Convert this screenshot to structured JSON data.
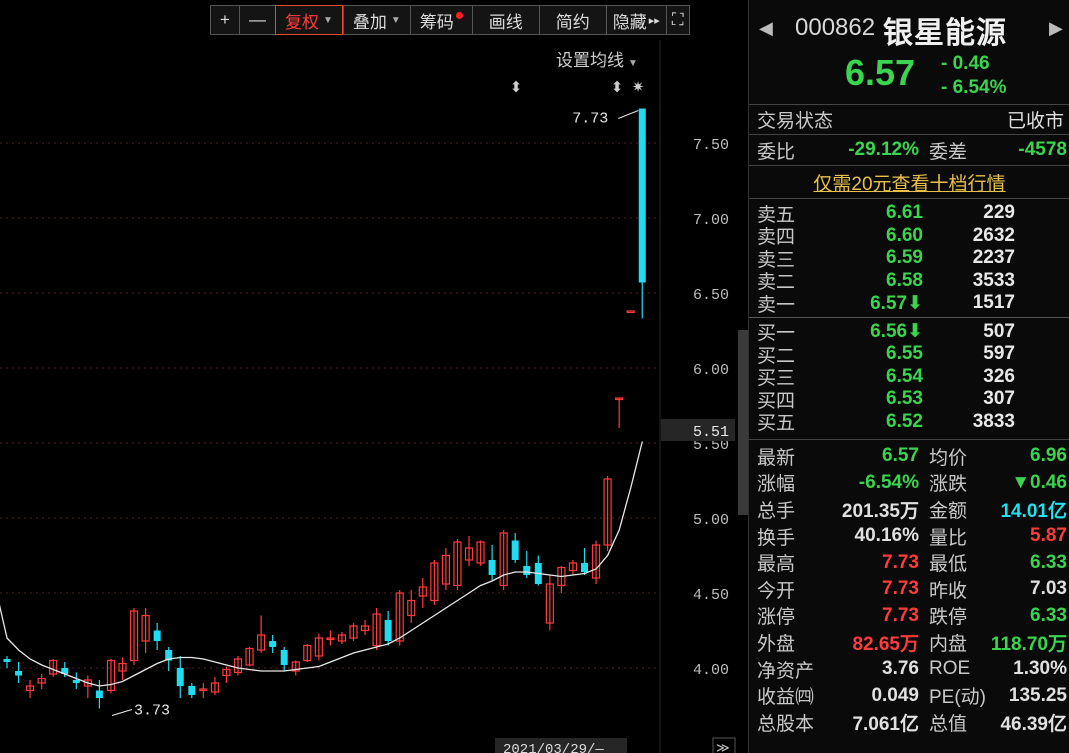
{
  "toolbar": {
    "items": [
      "+",
      "—",
      "复权",
      "叠加",
      "筹码",
      "画线",
      "简约",
      "隐藏",
      "⛶"
    ],
    "hidden_arrow": "▸▸"
  },
  "chart": {
    "ma_settings": "设置均线",
    "date_label": "2021/03/29/—",
    "peak_label": "7.73",
    "trough_label": "3.73",
    "current_price_tag": "5.51",
    "markers": [
      "⬍",
      "⬍",
      "✷"
    ],
    "nav_icon": "≫"
  },
  "chart_data": {
    "type": "candlestick",
    "y_ticks": [
      "7.50",
      "7.00",
      "6.50",
      "6.00",
      "5.50",
      "5.00",
      "4.50",
      "4.00"
    ],
    "ylim": [
      3.6,
      7.85
    ],
    "colors": {
      "up": "#ff3b3b",
      "down": "#21dcf0",
      "ma": "#e8e8e8"
    },
    "candles": [
      [
        4.06,
        4.08,
        4.0,
        4.04
      ],
      [
        3.98,
        4.04,
        3.9,
        3.95
      ],
      [
        3.85,
        3.92,
        3.8,
        3.88
      ],
      [
        3.9,
        3.96,
        3.86,
        3.93
      ],
      [
        3.96,
        4.06,
        3.94,
        4.05
      ],
      [
        4.0,
        4.04,
        3.94,
        3.96
      ],
      [
        3.92,
        3.97,
        3.86,
        3.9
      ],
      [
        3.88,
        3.95,
        3.8,
        3.92
      ],
      [
        3.85,
        3.92,
        3.73,
        3.8
      ],
      [
        3.85,
        4.06,
        3.83,
        4.05
      ],
      [
        3.98,
        4.07,
        3.92,
        4.03
      ],
      [
        4.05,
        4.4,
        4.02,
        4.38
      ],
      [
        4.18,
        4.4,
        4.1,
        4.35
      ],
      [
        4.25,
        4.3,
        4.12,
        4.18
      ],
      [
        4.12,
        4.14,
        3.98,
        4.05
      ],
      [
        4.0,
        4.08,
        3.8,
        3.88
      ],
      [
        3.88,
        3.9,
        3.8,
        3.82
      ],
      [
        3.86,
        3.9,
        3.8,
        3.86
      ],
      [
        3.84,
        3.94,
        3.82,
        3.9
      ],
      [
        3.95,
        4.01,
        3.9,
        3.99
      ],
      [
        3.97,
        4.08,
        3.95,
        4.06
      ],
      [
        4.02,
        4.14,
        4.01,
        4.13
      ],
      [
        4.12,
        4.35,
        4.1,
        4.22
      ],
      [
        4.18,
        4.22,
        4.1,
        4.14
      ],
      [
        4.12,
        4.14,
        3.98,
        4.02
      ],
      [
        3.98,
        4.05,
        3.95,
        4.04
      ],
      [
        4.05,
        4.16,
        4.04,
        4.15
      ],
      [
        4.08,
        4.23,
        4.05,
        4.2
      ],
      [
        4.2,
        4.25,
        4.15,
        4.2
      ],
      [
        4.18,
        4.24,
        4.16,
        4.22
      ],
      [
        4.2,
        4.3,
        4.18,
        4.28
      ],
      [
        4.25,
        4.32,
        4.22,
        4.28
      ],
      [
        4.15,
        4.4,
        4.12,
        4.36
      ],
      [
        4.32,
        4.38,
        4.15,
        4.18
      ],
      [
        4.18,
        4.52,
        4.15,
        4.5
      ],
      [
        4.35,
        4.52,
        4.3,
        4.45
      ],
      [
        4.48,
        4.6,
        4.4,
        4.54
      ],
      [
        4.45,
        4.72,
        4.42,
        4.7
      ],
      [
        4.56,
        4.8,
        4.52,
        4.75
      ],
      [
        4.55,
        4.86,
        4.52,
        4.84
      ],
      [
        4.72,
        4.88,
        4.68,
        4.8
      ],
      [
        4.7,
        4.85,
        4.68,
        4.84
      ],
      [
        4.72,
        4.82,
        4.58,
        4.62
      ],
      [
        4.55,
        4.92,
        4.52,
        4.9
      ],
      [
        4.85,
        4.9,
        4.7,
        4.72
      ],
      [
        4.68,
        4.78,
        4.6,
        4.62
      ],
      [
        4.7,
        4.75,
        4.55,
        4.56
      ],
      [
        4.3,
        4.62,
        4.25,
        4.56
      ],
      [
        4.55,
        4.68,
        4.5,
        4.67
      ],
      [
        4.65,
        4.72,
        4.62,
        4.7
      ],
      [
        4.7,
        4.8,
        4.62,
        4.64
      ],
      [
        4.6,
        4.85,
        4.56,
        4.82
      ],
      [
        4.82,
        5.28,
        4.78,
        5.26
      ],
      [
        5.8,
        5.8,
        5.6,
        5.8
      ],
      [
        6.38,
        6.38,
        6.38,
        6.38
      ],
      [
        7.73,
        7.73,
        6.33,
        6.57
      ]
    ],
    "ma": [
      4.2,
      4.12,
      4.06,
      4.02,
      3.99,
      3.96,
      3.93,
      3.9,
      3.88,
      3.89,
      3.91,
      3.95,
      3.99,
      4.03,
      4.06,
      4.07,
      4.07,
      4.06,
      4.04,
      4.02,
      4.0,
      3.99,
      3.98,
      3.98,
      3.98,
      3.99,
      4.0,
      4.01,
      4.04,
      4.07,
      4.1,
      4.12,
      4.14,
      4.16,
      4.2,
      4.25,
      4.3,
      4.35,
      4.4,
      4.45,
      4.5,
      4.55,
      4.58,
      4.62,
      4.64,
      4.64,
      4.63,
      4.62,
      4.61,
      4.62,
      4.63,
      4.66,
      4.75,
      4.92,
      5.2,
      5.51
    ]
  },
  "quote": {
    "code": "000862",
    "name": "银星能源",
    "price": "6.57",
    "change": "- 0.46",
    "change_pct": "- 6.54%",
    "status_label": "交易状态",
    "status_value": "已收市",
    "weibi_label": "委比",
    "weibi_value": "-29.12%",
    "weicha_label": "委差",
    "weicha_value": "-4578",
    "promo_link": "仅需20元查看十档行情"
  },
  "order_book": {
    "asks": [
      {
        "label": "卖五",
        "price": "6.61",
        "vol": "229"
      },
      {
        "label": "卖四",
        "price": "6.60",
        "vol": "2632"
      },
      {
        "label": "卖三",
        "price": "6.59",
        "vol": "2237"
      },
      {
        "label": "卖二",
        "price": "6.58",
        "vol": "3533"
      },
      {
        "label": "卖一",
        "price": "6.57⬇",
        "vol": "1517"
      }
    ],
    "bids": [
      {
        "label": "买一",
        "price": "6.56⬇",
        "vol": "507"
      },
      {
        "label": "买二",
        "price": "6.55",
        "vol": "597"
      },
      {
        "label": "买三",
        "price": "6.54",
        "vol": "326"
      },
      {
        "label": "买四",
        "price": "6.53",
        "vol": "307"
      },
      {
        "label": "买五",
        "price": "6.52",
        "vol": "3833"
      }
    ]
  },
  "stats": [
    {
      "l1": "最新",
      "v1": "6.57",
      "c1": "g",
      "l2": "均价",
      "v2": "6.96",
      "c2": "g"
    },
    {
      "l1": "涨幅",
      "v1": "-6.54%",
      "c1": "g",
      "l2": "涨跌",
      "v2": "▼0.46",
      "c2": "g"
    },
    {
      "l1": "总手",
      "v1": "201.35万",
      "c1": "w",
      "l2": "金额",
      "v2": "14.01亿",
      "c2": "c"
    },
    {
      "l1": "换手",
      "v1": "40.16%",
      "c1": "w",
      "l2": "量比",
      "v2": "5.87",
      "c2": "r"
    },
    {
      "l1": "最高",
      "v1": "7.73",
      "c1": "r",
      "l2": "最低",
      "v2": "6.33",
      "c2": "g"
    },
    {
      "l1": "今开",
      "v1": "7.73",
      "c1": "r",
      "l2": "昨收",
      "v2": "7.03",
      "c2": "w"
    },
    {
      "l1": "涨停",
      "v1": "7.73",
      "c1": "r",
      "l2": "跌停",
      "v2": "6.33",
      "c2": "g"
    },
    {
      "l1": "外盘",
      "v1": "82.65万",
      "c1": "r",
      "l2": "内盘",
      "v2": "118.70万",
      "c2": "g"
    },
    {
      "l1": "净资产",
      "v1": "3.76",
      "c1": "w",
      "l2": "ROE",
      "v2": "1.30%",
      "c2": "w"
    },
    {
      "l1": "收益㈣",
      "v1": "0.049",
      "c1": "w",
      "l2": "PE(动)",
      "v2": "135.25",
      "c2": "w"
    },
    {
      "l1": "总股本",
      "v1": "7.061亿",
      "c1": "w",
      "l2": "总值",
      "v2": "46.39亿",
      "c2": "w"
    }
  ]
}
